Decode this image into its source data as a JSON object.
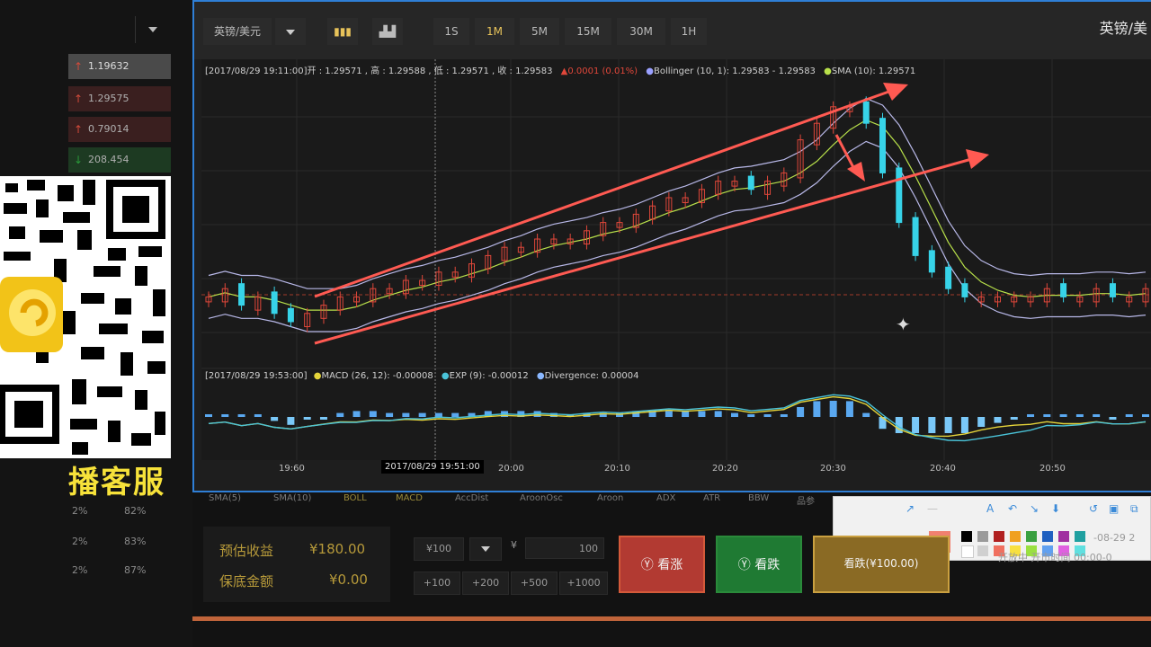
{
  "left_panel": {
    "prices": [
      {
        "value": "1.19632",
        "direction": "up",
        "color": "#d24a3a"
      },
      {
        "value": "1.29575",
        "direction": "up",
        "color": "#d24a3a"
      },
      {
        "value": "0.79014",
        "direction": "up",
        "color": "#d24a3a"
      },
      {
        "value": "208.454",
        "direction": "down",
        "color": "#2a9a3a"
      }
    ],
    "banner": "播客服",
    "percent_rows": [
      {
        "a": "2%",
        "b": "82%"
      },
      {
        "a": "2%",
        "b": "83%"
      },
      {
        "a": "2%",
        "b": "87%"
      }
    ]
  },
  "toolbar": {
    "pair": "英镑/美元",
    "timeframes": [
      "1S",
      "1M",
      "5M",
      "15M",
      "30M",
      "1H"
    ],
    "active_timeframe": "1M",
    "pair_right": "英镑/美"
  },
  "chart": {
    "info_line": "[2017/08/29 19:11:00]开 : 1.29571 , 高 : 1.29588 , 低 : 1.29571 , 收 : 1.29583",
    "change": "▲0.0001 (0.01%)",
    "bollinger": "Bollinger (10, 1): 1.29583 - 1.29583",
    "sma": "SMA (10): 1.29571",
    "macd_line": "[2017/08/29 19:53:00]",
    "macd": "MACD (26, 12): -0.00008",
    "exp": "EXP (9): -0.00012",
    "divergence": "Divergence: 0.00004",
    "x_ticks": [
      "19:60",
      "20:00",
      "20:10",
      "20:20",
      "20:30",
      "20:40",
      "20:50"
    ],
    "tooltip_time": "2017/08/29 19:51:00"
  },
  "chart_data": {
    "type": "candlestick",
    "pair": "英镑/美元",
    "timeframe": "1M",
    "x_ticks": [
      "19:60",
      "20:00",
      "20:10",
      "20:20",
      "20:30",
      "20:40",
      "20:50"
    ],
    "close_series": [
      3,
      4,
      2,
      3,
      1,
      0,
      1,
      2,
      3,
      3,
      4,
      4,
      5,
      5,
      6,
      6,
      7,
      8,
      9,
      9,
      10,
      10,
      10,
      11,
      12,
      12,
      13,
      14,
      15,
      15,
      16,
      17,
      17,
      16,
      17,
      18,
      22,
      24,
      26,
      26,
      24,
      18,
      12,
      8,
      6,
      4,
      3,
      3,
      3,
      3,
      3,
      4,
      3,
      3,
      4,
      3,
      3,
      4
    ]
  },
  "indicator_tabs": [
    "SMA(5)",
    "SMA(10)",
    "BOLL",
    "MACD",
    "AccDist",
    "AroonOsc",
    "Aroon",
    "ADX",
    "ATR",
    "BBW",
    "品参"
  ],
  "trade_panel": {
    "profit_label": "预估收益",
    "profit_value": "¥180.00",
    "guarantee_label": "保底金额",
    "guarantee_value": "¥0.00",
    "amount_value": "¥100",
    "currency": "¥",
    "amount_right": "100",
    "quick_amounts": [
      "+100",
      "+200",
      "+500",
      "+1000"
    ],
    "rise_label": "看涨",
    "fall_label": "看跌",
    "bet_label": "看跌(¥100.00)",
    "status": "开放中  开市时间  00:00-0",
    "date": "-08-29 2"
  }
}
